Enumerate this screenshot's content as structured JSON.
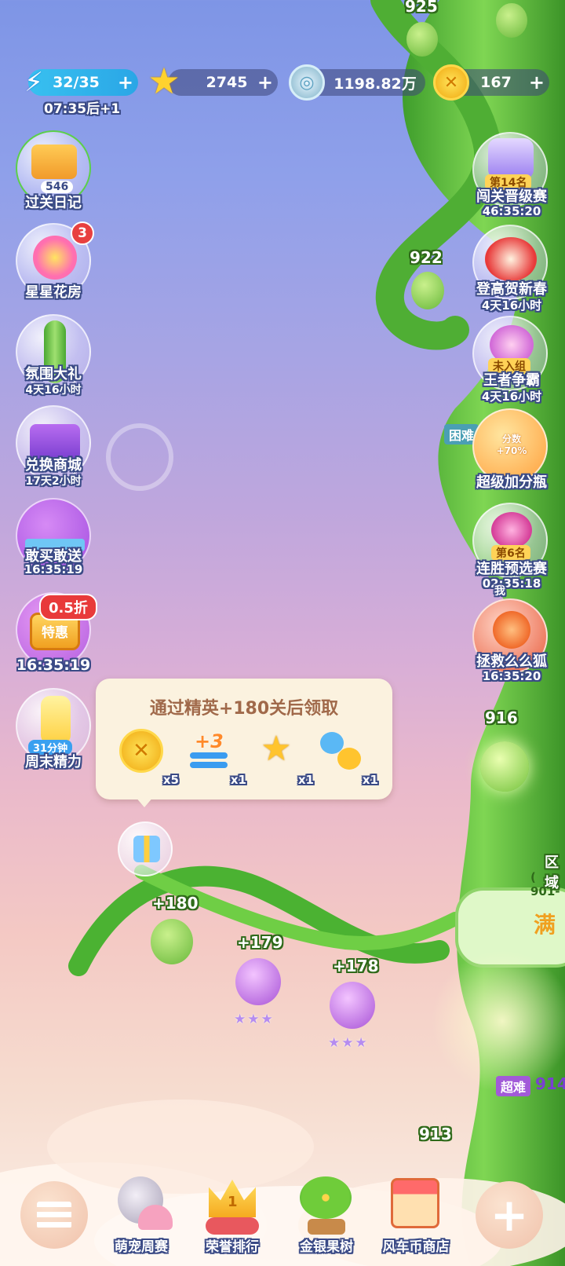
{
  "topbar": {
    "energy": {
      "value": "32/35",
      "timer": "07:35后+1",
      "icon": "lightning-icon"
    },
    "stars": {
      "value": "2745",
      "icon": "star-icon"
    },
    "coins": {
      "value": "1198.82万",
      "icon": "silver-coin-icon"
    },
    "gold": {
      "value": "167",
      "icon": "gold-coin-icon"
    },
    "plus": "+"
  },
  "left_menu": [
    {
      "label": "过关日记",
      "badge": "546",
      "icon": "diary-icon"
    },
    {
      "label": "星星花房",
      "badge": "3",
      "icon": "flower-house-icon"
    },
    {
      "label": "氛围大礼",
      "timer": "4天16小时",
      "icon": "beanstalk-gift-icon"
    },
    {
      "label": "兑换商城",
      "timer": "17天2小时",
      "icon": "exchange-shop-icon"
    },
    {
      "label": "敢买敢送",
      "timer": "16:35:19",
      "icon": "buy-gift-icon"
    },
    {
      "label": "16:35:19",
      "badge": "0.5折",
      "tag": "特惠",
      "icon": "special-offer-icon"
    },
    {
      "label": "周末精力",
      "tag": "31分钟",
      "icon": "energy-bottle-icon"
    }
  ],
  "right_menu": [
    {
      "label": "闯关晋级赛",
      "tag": "第14名",
      "timer": "46:35:20",
      "icon": "trophy-icon"
    },
    {
      "label": "登高贺新春",
      "timer": "4天16小时",
      "icon": "lion-dance-icon"
    },
    {
      "label": "王者争霸",
      "tag": "未入组",
      "timer": "4天16小时",
      "icon": "king-badge-icon"
    },
    {
      "label": "超级加分瓶",
      "tag": "分数+70%",
      "icon": "score-bottle-icon"
    },
    {
      "label": "连胜预选赛",
      "tag": "第6名",
      "timer": "02:35:18",
      "icon": "winstreak-icon"
    },
    {
      "label": "拯救么么狐",
      "tag": "我",
      "timer": "16:35:20",
      "icon": "fox-icon"
    }
  ],
  "difficulty_tags": {
    "hard": "困难",
    "super_hard": "超难"
  },
  "levels": {
    "l925": "925",
    "l922": "922",
    "l916": "916",
    "l914": "914",
    "l913": "913",
    "p180": "+180",
    "p179": "+179",
    "p178": "+178"
  },
  "zone": {
    "title": "区域",
    "range": "( 901-",
    "cta": "满"
  },
  "popup": {
    "title": "通过精英+180关后领取",
    "rewards": [
      {
        "icon": "gold-coin-icon",
        "count": "x5"
      },
      {
        "icon": "plus3-moves-icon",
        "label": "+3",
        "count": "x1"
      },
      {
        "icon": "magic-wand-icon",
        "count": "x1"
      },
      {
        "icon": "animal-swap-icon",
        "count": "x1"
      }
    ]
  },
  "bottom_nav": [
    {
      "label": "",
      "icon": "menu-icon"
    },
    {
      "label": "萌宠周赛",
      "icon": "pet-cat-icon"
    },
    {
      "label": "荣誉排行",
      "icon": "crown-icon",
      "rank": "1"
    },
    {
      "label": "金银果树",
      "icon": "fruit-tree-icon"
    },
    {
      "label": "风车币商店",
      "icon": "shop-icon"
    },
    {
      "label": "",
      "icon": "plus-icon"
    }
  ],
  "colors": {
    "energy_bar": "#3bc3f0",
    "badge_red": "#e84040",
    "beanstalk_green": "#5fbf3a",
    "popup_bg": "#fbf2df",
    "popup_text": "#a0694a"
  }
}
